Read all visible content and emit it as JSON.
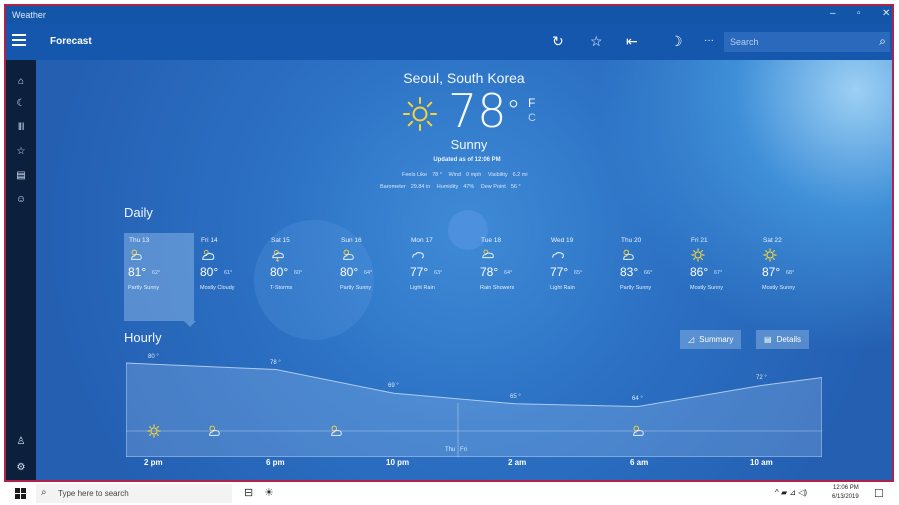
{
  "window": {
    "title": "Weather",
    "controls": [
      "–",
      "▫",
      "✕"
    ]
  },
  "appbar": {
    "page_title": "Forecast",
    "search_placeholder": "Search",
    "more_label": "···"
  },
  "left_nav": {
    "items": [
      "home-icon",
      "forecast-map-icon",
      "historical-icon",
      "favorites-icon",
      "news-icon",
      "smiley-icon",
      "account-icon",
      "settings-icon"
    ]
  },
  "current": {
    "location": "Seoul, South Korea",
    "temperature": "78",
    "degree_symbol": "°",
    "unit_f": "F",
    "unit_c": "C",
    "condition": "Sunny",
    "updated": "Updated as of 12:06 PM",
    "details_row1": [
      {
        "label": "Feels Like",
        "value": "78 °"
      },
      {
        "label": "Wind",
        "value": "0 mph"
      },
      {
        "label": "Visibility",
        "value": "6.2 mi"
      }
    ],
    "details_row2": [
      {
        "label": "Barometer",
        "value": "29.84 in"
      },
      {
        "label": "Humidity",
        "value": "47%"
      },
      {
        "label": "Dew Point",
        "value": "56 °"
      }
    ]
  },
  "daily": {
    "title": "Daily",
    "days": [
      {
        "name": "Thu 13",
        "high": "81°",
        "low": "62°",
        "condition": "Partly Sunny",
        "icon": "partly-sunny-icon"
      },
      {
        "name": "Fri 14",
        "high": "80°",
        "low": "61°",
        "condition": "Mostly Cloudy",
        "icon": "mostly-cloudy-icon"
      },
      {
        "name": "Sat 15",
        "high": "80°",
        "low": "60°",
        "condition": "T-Storms",
        "icon": "thunderstorm-icon"
      },
      {
        "name": "Sun 16",
        "high": "80°",
        "low": "64°",
        "condition": "Partly Sunny",
        "icon": "partly-sunny-icon"
      },
      {
        "name": "Mon 17",
        "high": "77°",
        "low": "63°",
        "condition": "Light Rain",
        "icon": "light-rain-icon"
      },
      {
        "name": "Tue 18",
        "high": "78°",
        "low": "64°",
        "condition": "Rain Showers",
        "icon": "rain-showers-icon"
      },
      {
        "name": "Wed 19",
        "high": "77°",
        "low": "65°",
        "condition": "Light Rain",
        "icon": "light-rain-icon"
      },
      {
        "name": "Thu 20",
        "high": "83°",
        "low": "66°",
        "condition": "Partly Sunny",
        "icon": "partly-sunny-icon"
      },
      {
        "name": "Fri 21",
        "high": "86°",
        "low": "67°",
        "condition": "Mostly Sunny",
        "icon": "sunny-icon"
      },
      {
        "name": "Sat 22",
        "high": "87°",
        "low": "68°",
        "condition": "Mostly Sunny",
        "icon": "sunny-icon"
      }
    ]
  },
  "hourly": {
    "title": "Hourly",
    "summary_label": "Summary",
    "details_label": "Details",
    "day_divider_labels": [
      "Thu",
      "Fri"
    ],
    "temps": [
      {
        "label": "80 °",
        "value": 80
      },
      {
        "label": "78 °",
        "value": 78
      },
      {
        "label": "69 °",
        "value": 69
      },
      {
        "label": "65 °",
        "value": 65
      },
      {
        "label": "64 °",
        "value": 64
      },
      {
        "label": "72 °",
        "value": 72
      }
    ],
    "times": [
      "2 pm",
      "6 pm",
      "10 pm",
      "2 am",
      "6 am",
      "10 am"
    ]
  },
  "taskbar": {
    "search_placeholder": "Type here to search",
    "clock_time": "12:06 PM",
    "clock_date": "6/13/2019",
    "tray_icons": "^ ▰ ⊿ ◁)"
  },
  "colors": {
    "accent": "#1557ad",
    "nav": "#0c1f3c",
    "sun": "#f5d33a",
    "frame": "#b0224a"
  }
}
